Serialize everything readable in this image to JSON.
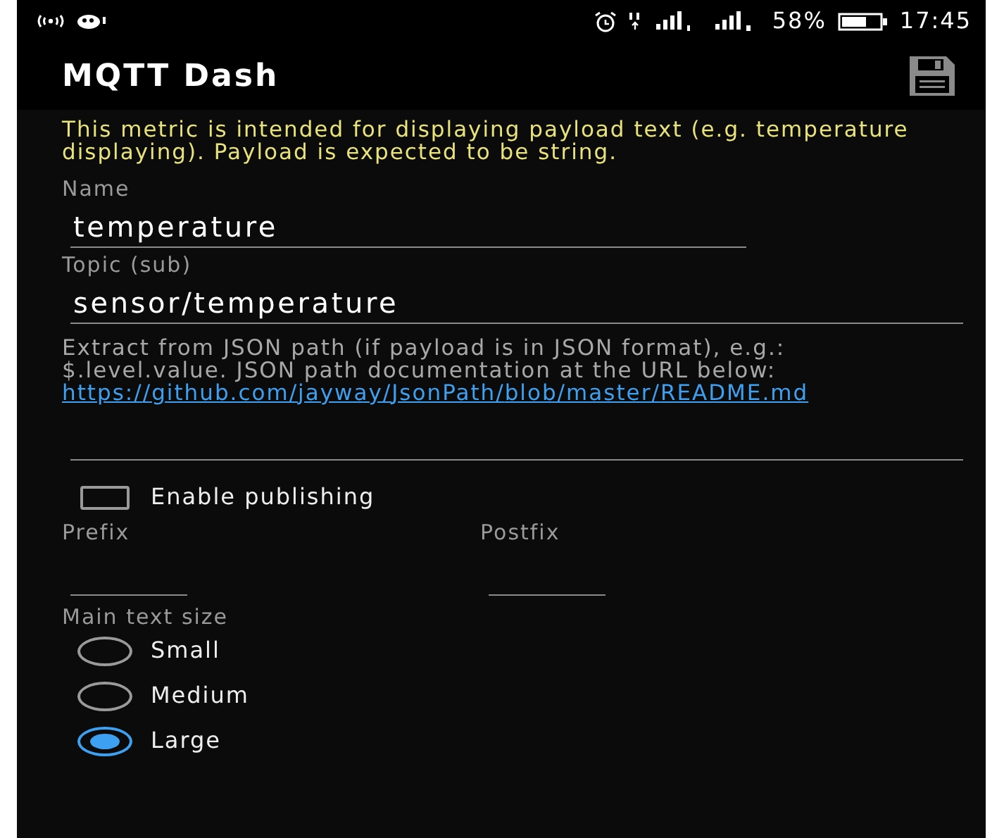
{
  "status_bar": {
    "battery": "58%",
    "time": "17:45"
  },
  "app_bar": {
    "title": "MQTT Dash"
  },
  "description": "This metric is intended for displaying payload text (e.g. temperature displaying). Payload is expected to be string.",
  "fields": [
    {
      "label": "Name",
      "value": "temperature"
    },
    {
      "label": "Topic (sub)",
      "value": "sensor/temperature"
    }
  ],
  "json_path": {
    "help": "Extract from JSON path (if payload is in JSON format), e.g.: $.level.value. JSON path documentation at the URL below:",
    "link": "https://github.com/jayway/JsonPath/blob/master/README.md"
  },
  "enable_publishing": {
    "label": "Enable publishing",
    "checked": false
  },
  "prefix": {
    "label": "Prefix"
  },
  "postfix": {
    "label": "Postfix"
  },
  "text_size": {
    "label": "Main text size",
    "options": [
      {
        "label": "Small",
        "selected": false
      },
      {
        "label": "Medium",
        "selected": false
      },
      {
        "label": "Large",
        "selected": true
      }
    ]
  }
}
